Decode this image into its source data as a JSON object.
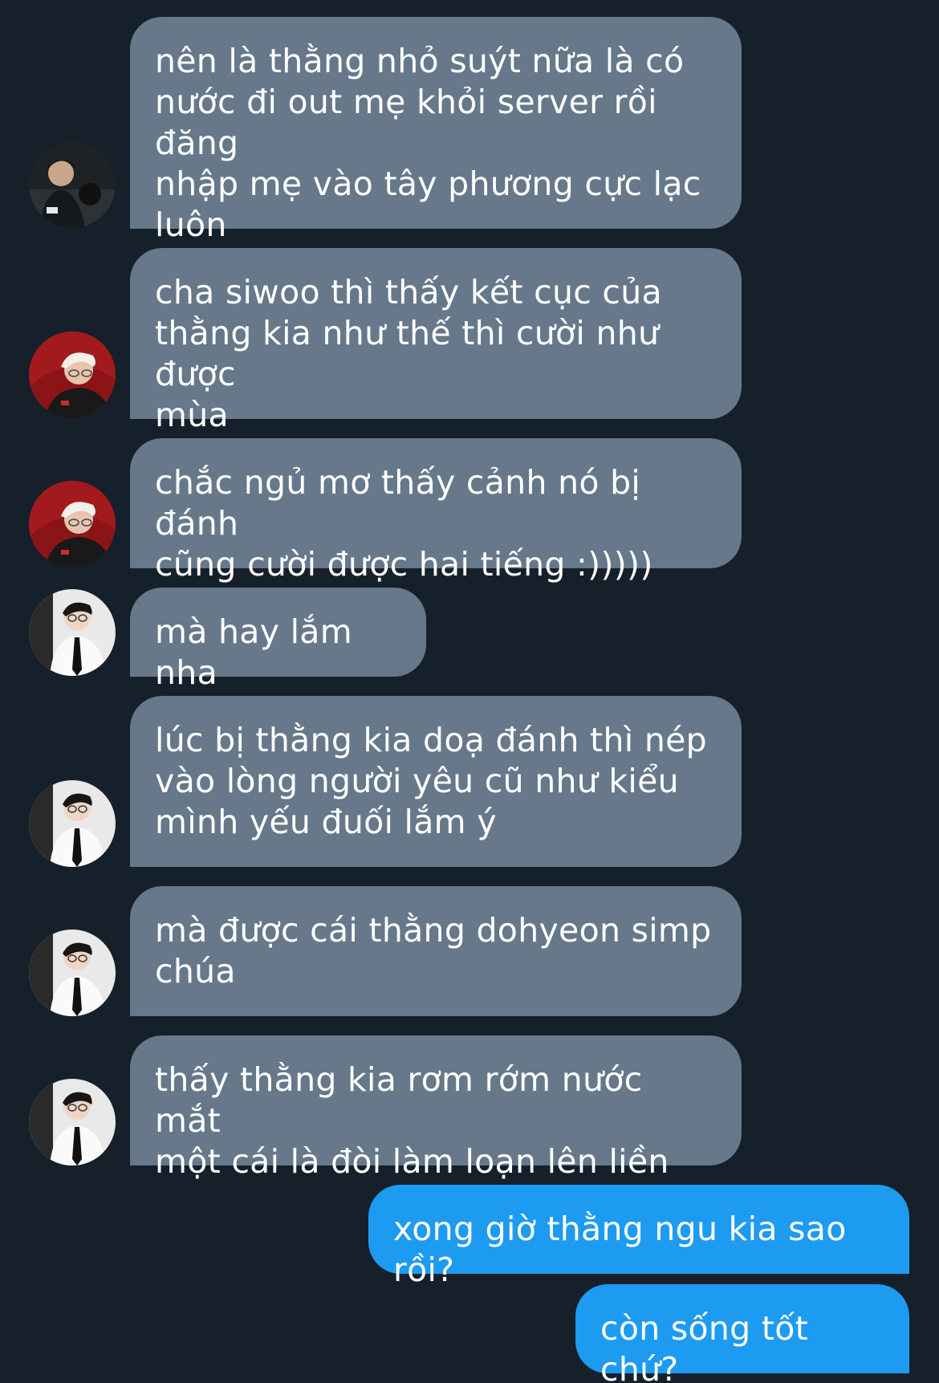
{
  "conversation": {
    "messages": [
      {
        "sender": "other",
        "avatar": "avatar-photo-dark-hair",
        "text": "nên là thằng nhỏ suýt nữa là có\nnước đi out mẹ khỏi server rồi đăng\nnhập mẹ vào tây phương cực lạc\nluôn"
      },
      {
        "sender": "other",
        "avatar": "avatar-photo-blonde-red",
        "text": "cha siwoo thì thấy kết cục của\nthằng kia như thế thì cười như được\nmùa"
      },
      {
        "sender": "other",
        "avatar": "avatar-photo-blonde-red",
        "text": "chắc ngủ mơ thấy cảnh nó bị đánh\ncũng cười được hai tiếng :)))))"
      },
      {
        "sender": "other",
        "avatar": "avatar-photo-suit-glasses",
        "text": "mà hay lắm nha"
      },
      {
        "sender": "other",
        "avatar": "avatar-photo-suit-glasses",
        "text": "lúc bị thằng kia doạ đánh thì nép\nvào lòng người yêu cũ như kiểu\nmình yếu đuối lắm ý"
      },
      {
        "sender": "other",
        "avatar": "avatar-photo-suit-glasses",
        "text": "mà được cái thằng dohyeon simp\nchúa"
      },
      {
        "sender": "other",
        "avatar": "avatar-photo-suit-glasses",
        "text": "thấy thằng kia rơm rớm nước mắt\nmột cái là đòi làm loạn lên liền"
      },
      {
        "sender": "me",
        "text": "xong giờ thằng ngu kia sao rồi?"
      },
      {
        "sender": "me",
        "text": "còn sống tốt chứ?"
      }
    ]
  },
  "colors": {
    "background": "#15202b",
    "received_bubble": "#66788a",
    "sent_bubble": "#1d9bf0",
    "text": "#ffffff"
  }
}
